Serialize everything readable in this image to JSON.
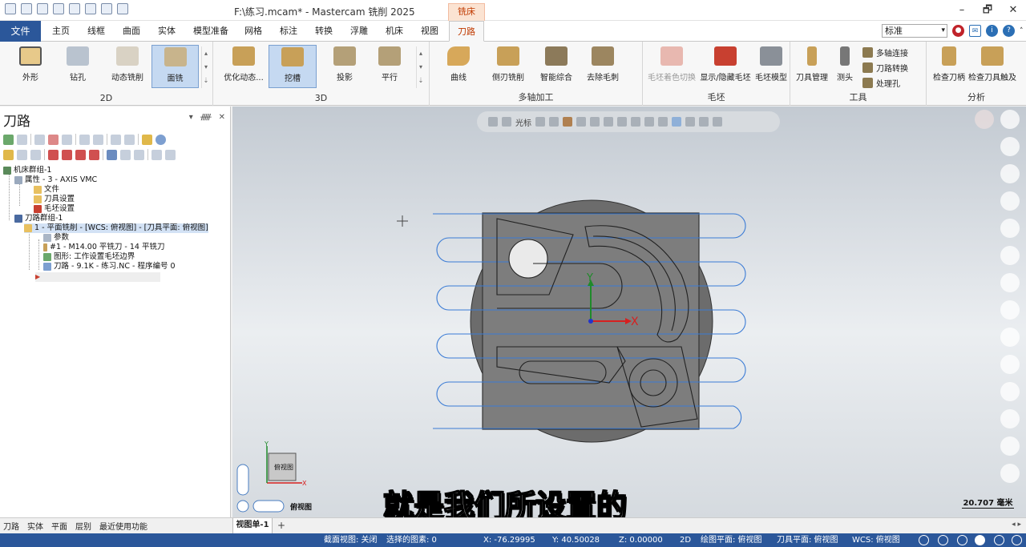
{
  "title": {
    "text": "F:\\练习.mcam* - Mastercam 铣削 2025",
    "context_tab": "铣床"
  },
  "window_controls": [
    "–",
    "🗗",
    "✕"
  ],
  "menu_tabs": [
    "文件",
    "主页",
    "线框",
    "曲面",
    "实体",
    "模型准备",
    "网格",
    "标注",
    "转换",
    "浮雕",
    "机床",
    "视图",
    "刀路"
  ],
  "right_controls": {
    "standard": "标准"
  },
  "ribbon": {
    "g2d": {
      "label": "2D",
      "buttons": [
        "外形",
        "钻孔",
        "动态铣削",
        "面铣"
      ]
    },
    "g3d": {
      "label": "3D",
      "buttons": [
        "优化动态...",
        "挖槽",
        "投影",
        "平行"
      ]
    },
    "gmulti": {
      "label": "多轴加工",
      "buttons": [
        "曲线",
        "侧刃铣削",
        "智能综合",
        "去除毛刺"
      ]
    },
    "gstock": {
      "label": "毛坯",
      "buttons": [
        "毛坯着色切换",
        "显示/隐藏毛坯",
        "毛坯模型"
      ]
    },
    "gtools": {
      "label": "工具",
      "buttons": [
        "刀具管理",
        "测头"
      ],
      "small": [
        "多轴连接",
        "刀路转换",
        "处理孔"
      ]
    },
    "ganalysis": {
      "label": "分析",
      "buttons": [
        "检查刀柄",
        "检查刀具触及"
      ]
    }
  },
  "panel": {
    "title": "刀路",
    "controls": [
      "▾",
      "ᚏ",
      "✕"
    ],
    "tree": [
      "机床群组-1",
      "属性 - 3 - AXIS VMC",
      "文件",
      "刀具设置",
      "毛坯设置",
      "刀路群组-1",
      "1 - 平面铣削 - [WCS: 俯视图] - [刀具平面: 俯视图]",
      "参数",
      "#1 - M14.00 平铣刀 - 14 平铣刀",
      "图形: 工作设置毛坯边界",
      "刀路 - 9.1K - 练习.NC - 程序编号 0"
    ],
    "bottom_tabs": [
      "刀路",
      "实体",
      "平面",
      "层别",
      "最近使用功能"
    ]
  },
  "viewport": {
    "toolbar_label": "光标",
    "axis_x": "X",
    "axis_y": "Y",
    "cube_label": "俯视图",
    "view_name": "俯视图",
    "subtitle": "就是我们所设置的",
    "scale": "20.707 毫米",
    "view_tab": "视图单-1",
    "add_tab": "+"
  },
  "status": {
    "section_view": "截面视图: 关闭",
    "selected": "选择的图素: 0",
    "x": "X:  -76.29995",
    "y": "Y:  40.50028",
    "z": "Z:  0.00000",
    "mode": "2D",
    "plane": "绘图平面: 俯视图",
    "tool_plane": "刀具平面: 俯视图",
    "wcs": "WCS: 俯视图"
  },
  "colors": {
    "accent": "#2b579a",
    "context": "#c03a00",
    "toolpath": "#3a7bd5"
  }
}
